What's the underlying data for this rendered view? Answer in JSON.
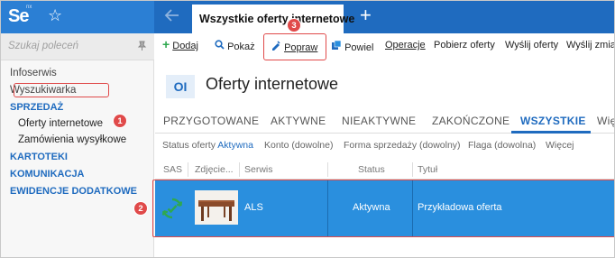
{
  "app": {
    "logo": "Se",
    "logo_sup": "nx"
  },
  "tabs_bar": {
    "active_tab": "Wszystkie oferty internetowe"
  },
  "sidebar": {
    "search_placeholder": "Szukaj poleceń",
    "items": [
      {
        "label": "Infoserwis",
        "kind": "item"
      },
      {
        "label": "Wyszukiwarka",
        "kind": "item"
      },
      {
        "label": "SPRZEDAŻ",
        "kind": "section"
      },
      {
        "label": "Oferty internetowe",
        "kind": "sub",
        "active": true
      },
      {
        "label": "Zamówienia wysyłkowe",
        "kind": "sub"
      },
      {
        "label": "KARTOTEKI",
        "kind": "section"
      },
      {
        "label": "KOMUNIKACJA",
        "kind": "section"
      },
      {
        "label": "EWIDENCJE DODATKOWE",
        "kind": "section"
      }
    ]
  },
  "toolbar": {
    "dodaj": "Dodaj",
    "pokaz": "Pokaż",
    "popraw": "Popraw",
    "powiel": "Powiel",
    "operacje": "Operacje",
    "pobierz": "Pobierz oferty",
    "wyslij": "Wyślij oferty",
    "wyslij_zmiany": "Wyślij zmian"
  },
  "page": {
    "badge": "OI",
    "title": "Oferty internetowe"
  },
  "status_tabs": [
    "PRZYGOTOWANE",
    "AKTYWNE",
    "NIEAKTYWNE",
    "ZAKOŃCZONE",
    "WSZYSTKIE",
    "Wię"
  ],
  "filters": {
    "status_label": "Status oferty",
    "status_value": "Aktywna",
    "konto": "Konto (dowolne)",
    "forma": "Forma sprzedaży (dowolny)",
    "flaga": "Flaga (dowolna)",
    "wiecej": "Więcej"
  },
  "grid": {
    "columns": [
      "SAS",
      "Zdjęcie...",
      "Serwis",
      "Status",
      "Tytuł"
    ],
    "rows": [
      {
        "serwis": "ALS",
        "status": "Aktywna",
        "tytul": "Przykładowa oferta"
      }
    ]
  },
  "annotations": [
    "1",
    "2",
    "3"
  ],
  "colors": {
    "accent": "#1f6bbf",
    "row_selected": "#2a8fde",
    "callout": "#e04a4a",
    "sync": "#2fa84f"
  }
}
